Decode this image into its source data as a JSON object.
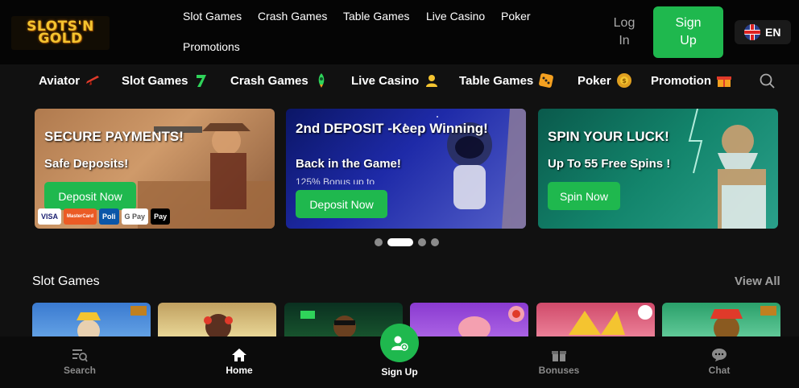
{
  "brand": {
    "logo_text": "SLOTS'N GOLD"
  },
  "top_nav": {
    "items": [
      "Slot Games",
      "Crash Games",
      "Table Games",
      "Live Casino",
      "Poker",
      "Promotions"
    ]
  },
  "auth": {
    "login_label": "Log In",
    "signup_label": "Sign Up"
  },
  "language": {
    "code": "EN"
  },
  "categories": [
    {
      "label": "Aviator",
      "icon": "plane-icon"
    },
    {
      "label": "Slot Games",
      "icon": "seven-icon"
    },
    {
      "label": "Crash Games",
      "icon": "rocket-icon"
    },
    {
      "label": "Live Casino",
      "icon": "dealer-icon"
    },
    {
      "label": "Table Games",
      "icon": "dice-icon"
    },
    {
      "label": "Poker",
      "icon": "chip-icon"
    },
    {
      "label": "Promotion",
      "icon": "gift-icon"
    }
  ],
  "banners": [
    {
      "title": "SECURE PAYMENTS!",
      "subtitle": "Safe Deposits!",
      "button": "Deposit Now",
      "payments": [
        "VISA",
        "MasterCard",
        "Poli",
        "G Pay",
        "Pay"
      ]
    },
    {
      "title": "2nd DEPOSIT -Keep Winning!",
      "subtitle": "Back in the Game!",
      "subtitle2": "125% Bonus up to",
      "button": "Deposit Now"
    },
    {
      "title": "SPIN YOUR LUCK!",
      "subtitle": "Up To 55 Free Spins !",
      "button": "Spin Now"
    }
  ],
  "carousel": {
    "slides": 4,
    "active_index": 1
  },
  "slot_section": {
    "title": "Slot Games",
    "view_all": "View All"
  },
  "bottom_nav": {
    "items": [
      {
        "label": "Search",
        "icon": "search-icon"
      },
      {
        "label": "Home",
        "icon": "home-icon"
      },
      {
        "label": "Sign Up",
        "icon": "user-plus-icon"
      },
      {
        "label": "Bonuses",
        "icon": "gift-icon"
      },
      {
        "label": "Chat",
        "icon": "chat-icon"
      }
    ],
    "active": "Home"
  },
  "colors": {
    "accent": "#1fb84e",
    "background": "#111111",
    "topbar": "#050505"
  }
}
